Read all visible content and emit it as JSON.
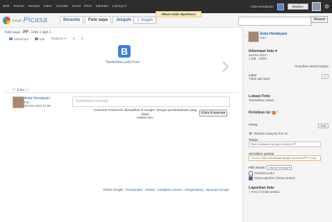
{
  "gbar": {
    "links": [
      "Web",
      "Telusuri",
      "Gambar",
      "Video",
      "YouTube",
      "Gmail",
      "Drive",
      "Kalender",
      "Lainnya ▾"
    ],
    "user_email": "Anita Hendayani",
    "signin_label": "Bagikan"
  },
  "header": {
    "logo_small": "Google",
    "logo_text": "Picasa",
    "tabs": [
      "Beranda",
      "Foto saya",
      "Jelajahi"
    ],
    "upload_label": "Unggah",
    "notice": "Album telah diperbarui.",
    "search_button": "Telusuri"
  },
  "breadcrumb": {
    "prefix": "Foto saya ›",
    "album": "FF",
    "suffix": "› Foto 1 dari 1"
  },
  "toolbar": [
    "Slideshow",
    "Edit",
    "Tindakan ▾",
    "↺",
    "↻"
  ],
  "viewer": {
    "photo_letter": "B",
    "caption": "Tambahkan judul Foto",
    "next_arrow": "›"
  },
  "like_label": "Suka",
  "owner": {
    "name": "Anita Hendayani",
    "role": "foto",
    "date": "29 Des 2013 11:05"
  },
  "comment": {
    "placeholder": "Tambahkan komentar",
    "note": "Komentar Picasa kini ditampilkan di Google+ dengan pemberitahuan yang ditulis",
    "note2": "melalui foto.",
    "submit": "Kirim Komentar"
  },
  "footer": {
    "copy": "©2011 Google",
    "links": [
      "Persyaratan",
      "Privasi",
      "Kebijakan Konten",
      "Pengembang",
      "Beranda Google"
    ]
  },
  "sidebar": {
    "author": "Anita Hendayani",
    "author_sub": "Foto",
    "info_title": "Informasi foto ▾",
    "info_date": "29 Des 2013",
    "info_meta": "1 MB · 100%",
    "details_link": "Tampilkan detail lengkap",
    "label_title": "Label",
    "label_empty": "Tidak ada label",
    "label_btn": "+",
    "location_title": "Lokasi Foto",
    "location_link": "Tambahkan lokasi",
    "share_title": "Kirimkan ke:",
    "people_title": "Orang",
    "people_btn": "Edit",
    "people_link": "Tambah orang ke foto ini",
    "link_label": "Tautan",
    "link_value": "https://picasaweb.google.com/photo/FF",
    "embed_label": "Sematkan gambar",
    "embed_value": "<a href=\"https://picasaweb.google.com/photo/FF\"><img",
    "size_label": "Pilih ukuran:",
    "size_value": "Ukuran sedang",
    "embed_opt1": "Sertakan judul",
    "embed_opt2": "Hanya gambar (tanpa tautan)",
    "report_title": "Laporkan foto",
    "report_text": "Foto ini tidak pantas"
  }
}
